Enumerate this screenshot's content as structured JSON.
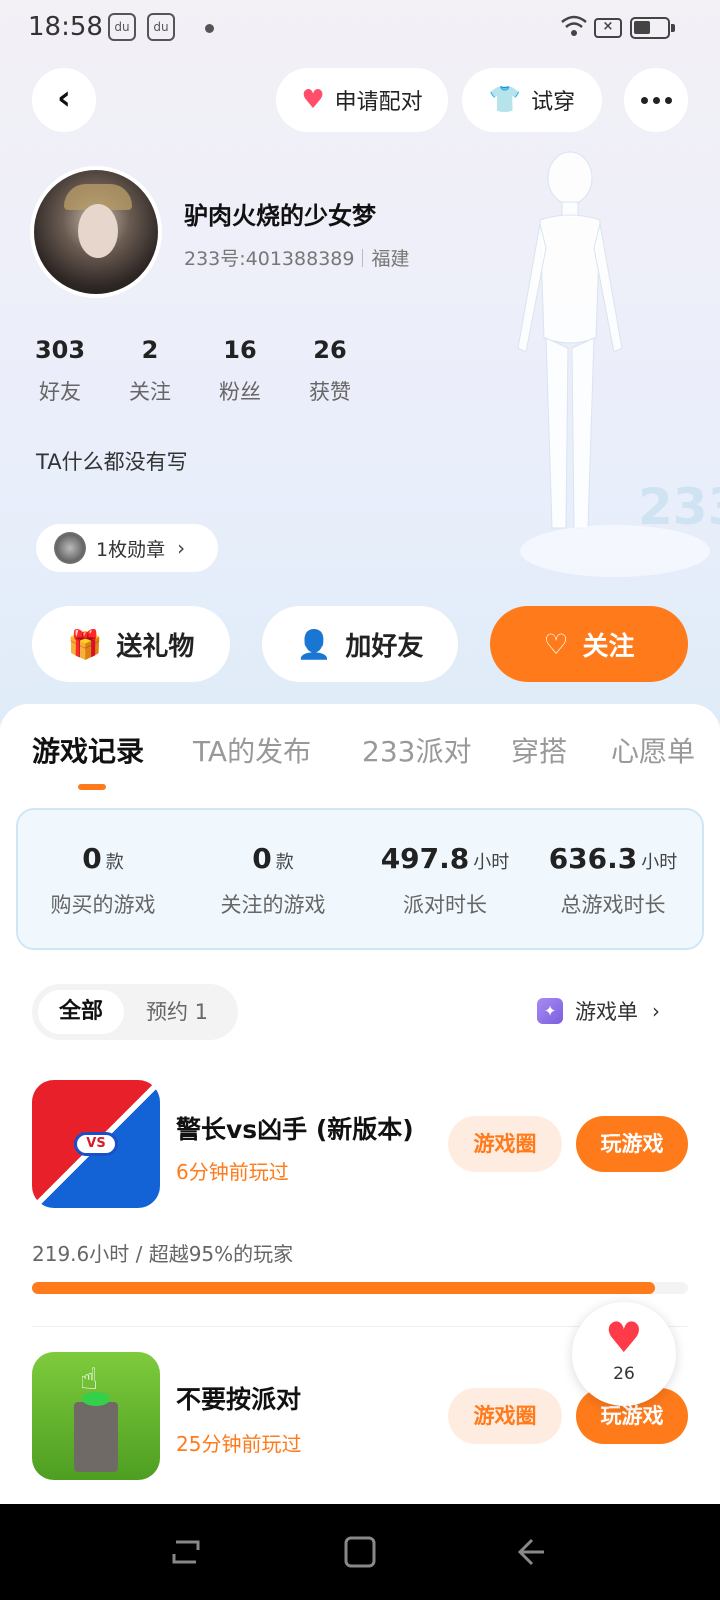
{
  "status_bar": {
    "time": "18:58",
    "icons": [
      "baidu-icon",
      "baidu-icon",
      "dot",
      "wifi-icon",
      "data-off-icon",
      "battery-icon"
    ]
  },
  "header": {
    "apply_pair_label": "申请配对",
    "try_on_label": "试穿"
  },
  "profile": {
    "nickname": "驴肉火烧的少女梦",
    "uid": "233号:401388389",
    "region": "福建",
    "stats": [
      {
        "value": "303",
        "label": "好友"
      },
      {
        "value": "2",
        "label": "关注"
      },
      {
        "value": "16",
        "label": "粉丝"
      },
      {
        "value": "26",
        "label": "获赞"
      }
    ],
    "bio": "TA什么都没有写",
    "medal_label": "1枚勋章"
  },
  "actions": {
    "gift_label": "送礼物",
    "add_friend_label": "加好友",
    "follow_label": "关注"
  },
  "tabs": [
    {
      "label": "游戏记录",
      "active": true
    },
    {
      "label": "TA的发布",
      "active": false
    },
    {
      "label": "233派对",
      "active": false
    },
    {
      "label": "穿搭",
      "active": false
    },
    {
      "label": "心愿单",
      "active": false
    }
  ],
  "summary": [
    {
      "value": "0",
      "unit": "款",
      "label": "购买的游戏"
    },
    {
      "value": "0",
      "unit": "款",
      "label": "关注的游戏"
    },
    {
      "value": "497.8",
      "unit": "小时",
      "label": "派对时长"
    },
    {
      "value": "636.3",
      "unit": "小时",
      "label": "总游戏时长"
    }
  ],
  "filters": {
    "all_label": "全部",
    "reserve_label": "预约 1"
  },
  "game_list_link": "游戏单",
  "games": [
    {
      "title": "警长vs凶手 (新版本)",
      "last_played": "6分钟前玩过",
      "circle_label": "游戏圈",
      "play_label": "玩游戏",
      "playtime_text": "219.6小时 / 超越95%的玩家",
      "progress_fraction": 0.95
    },
    {
      "title": "不要按派对",
      "last_played": "25分钟前玩过",
      "circle_label": "游戏圈",
      "play_label": "玩游戏"
    }
  ],
  "like_float": {
    "count": "26"
  },
  "colors": {
    "accent": "#ff7a1a",
    "accent_light": "#ffece0",
    "summary_bg": "#f1f8fd"
  }
}
